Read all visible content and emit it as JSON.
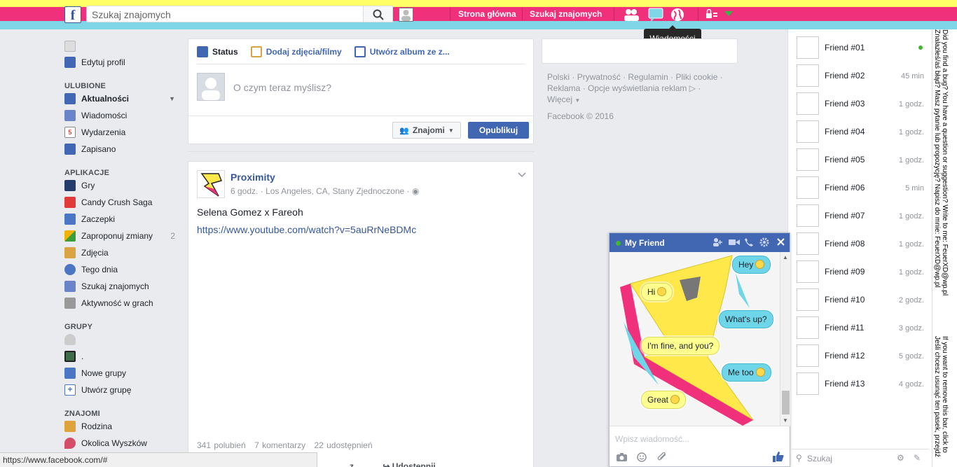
{
  "topbar": {
    "logo": "f",
    "search_placeholder": "Szukaj znajomych",
    "nav_home": "Strona główna",
    "nav_find": "Szukaj znajomych",
    "tooltip": "Wiadomości"
  },
  "left_nav": {
    "edit_profile": "Edytuj profil",
    "favorites_header": "ULUBIONE",
    "favorites": [
      {
        "label": "Aktualności",
        "icon": "news-feed-icon"
      },
      {
        "label": "Wiadomości",
        "icon": "messages-icon"
      },
      {
        "label": "Wydarzenia",
        "icon": "events-icon",
        "badge_text": "5"
      },
      {
        "label": "Zapisano",
        "icon": "bookmark-icon"
      }
    ],
    "apps_header": "APLIKACJE",
    "apps": [
      {
        "label": "Gry",
        "count": ""
      },
      {
        "label": "Candy Crush Saga",
        "count": ""
      },
      {
        "label": "Zaczepki",
        "count": ""
      },
      {
        "label": "Zaproponuj zmiany",
        "count": "2"
      },
      {
        "label": "Zdjęcia",
        "count": ""
      },
      {
        "label": "Tego dnia",
        "count": ""
      },
      {
        "label": "Szukaj znajomych",
        "count": ""
      },
      {
        "label": "Aktywność w grach",
        "count": ""
      }
    ],
    "groups_header": "GRUPY",
    "groups": [
      {
        "label": ""
      },
      {
        "label": "."
      },
      {
        "label": "Nowe grupy"
      },
      {
        "label": "Utwórz grupę"
      }
    ],
    "friends_header": "ZNAJOMI",
    "friends_lists": [
      {
        "label": "Rodzina"
      },
      {
        "label": "Okolica Wyszków"
      }
    ]
  },
  "composer": {
    "tab_status": "Status",
    "tab_photos": "Dodaj zdjęcia/filmy",
    "tab_album": "Utwórz album ze z...",
    "placeholder": "O czym teraz myślisz?",
    "audience": "Znajomi",
    "publish": "Opublikuj"
  },
  "post": {
    "author": "Proximity",
    "time": "6 godz.",
    "location": "Los Angeles, CA, Stany Zjednoczone",
    "text": "Selena Gomez x Fareoh",
    "link": "https://www.youtube.com/watch?v=5auRrNeBDMc",
    "likes": "341 polubień",
    "comments": "7 komentarzy",
    "shares": "22 udostępnień",
    "action_share": "Udostępnij",
    "action_partial": "z"
  },
  "right_footer": {
    "links_line1": [
      "Polski",
      "Prywatność",
      "Regulamin",
      "Pliki cookie"
    ],
    "links_line2": [
      "Reklama",
      "Opcje wyświetlania reklam"
    ],
    "more": "Więcej",
    "copyright": "Facebook © 2016"
  },
  "chat_sidebar": {
    "friends": [
      {
        "name": "Friend #01",
        "time": "",
        "online": true
      },
      {
        "name": "Friend #02",
        "time": "45 min",
        "online": false
      },
      {
        "name": "Friend #03",
        "time": "1 godz.",
        "online": false
      },
      {
        "name": "Friend #04",
        "time": "1 godz.",
        "online": false
      },
      {
        "name": "Friend #05",
        "time": "1 godz.",
        "online": false
      },
      {
        "name": "Friend #06",
        "time": "5 min",
        "online": false
      },
      {
        "name": "Friend #07",
        "time": "1 godz.",
        "online": false
      },
      {
        "name": "Friend #08",
        "time": "1 godz.",
        "online": false
      },
      {
        "name": "Friend #09",
        "time": "1 godz.",
        "online": false
      },
      {
        "name": "Friend #10",
        "time": "2 godz.",
        "online": false
      },
      {
        "name": "Friend #11",
        "time": "3 godz.",
        "online": false
      },
      {
        "name": "Friend #12",
        "time": "5 godz.",
        "online": false
      },
      {
        "name": "Friend #13",
        "time": "4 godz.",
        "online": false
      }
    ],
    "search_placeholder": "Szukaj"
  },
  "side_banner": {
    "line1": "Znalazłeś/aś błąd? Masz pytanie lub propozycję? Napisz do mnie: FeuerXD@wp.pl",
    "line2": "Did you find a bug? You have a question or suggestion? Write to me: FeuerXD@wp.pl",
    "line3": "Jeśli chcesz usunąć ten pasek, przejdź",
    "line4": "If you want to remove this bar, click to"
  },
  "chat_window": {
    "title": "My Friend",
    "messages": [
      {
        "text": "Hey",
        "side": "out"
      },
      {
        "text": "Hi",
        "side": "in"
      },
      {
        "text": "What's up?",
        "side": "out"
      },
      {
        "text": "I'm fine, and you?",
        "side": "in"
      },
      {
        "text": "Me too",
        "side": "out"
      },
      {
        "text": "Great",
        "side": "in"
      }
    ],
    "input_placeholder": "Wpisz wiadomość..."
  },
  "status_bar": {
    "url": "https://www.facebook.com/#"
  },
  "colors": {
    "brand": "#4267b2",
    "top_yellow": "#ffff66",
    "top_pink": "#f0307a",
    "top_cyan": "#7fd6e6",
    "bubble_in": "#ffff8f",
    "bubble_out": "#6ed6e8"
  }
}
